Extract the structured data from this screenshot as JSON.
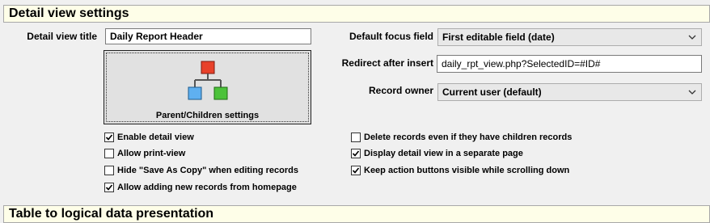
{
  "section_title": "Detail view settings",
  "next_section_title": "Table to logical data presentation",
  "detail_view_title": {
    "label": "Detail view title",
    "value": "Daily Report Header"
  },
  "default_focus": {
    "label": "Default focus field",
    "value": "First editable field (date)"
  },
  "redirect": {
    "label": "Redirect after insert",
    "value": "daily_rpt_view.php?SelectedID=#ID#"
  },
  "record_owner": {
    "label": "Record owner",
    "value": "Current user (default)"
  },
  "parent_children_button": {
    "label": "Parent/Children settings",
    "icon": "hierarchy-icon"
  },
  "checkboxes_left": [
    {
      "label": "Enable detail view",
      "checked": true
    },
    {
      "label": "Allow print-view",
      "checked": false
    },
    {
      "label": "Hide \"Save As Copy\" when editing records",
      "checked": false
    },
    {
      "label": "Allow adding new records from homepage",
      "checked": true
    }
  ],
  "checkboxes_right": [
    {
      "label": "Delete records even if they have children records",
      "checked": false
    },
    {
      "label": "Display detail view in a separate page",
      "checked": true
    },
    {
      "label": "Keep action buttons visible while scrolling down",
      "checked": true
    }
  ],
  "colors": {
    "header_bg": "#fefee8",
    "icon_red": "#e8412a",
    "icon_blue": "#5fb0f0",
    "icon_green": "#4cc23a"
  }
}
